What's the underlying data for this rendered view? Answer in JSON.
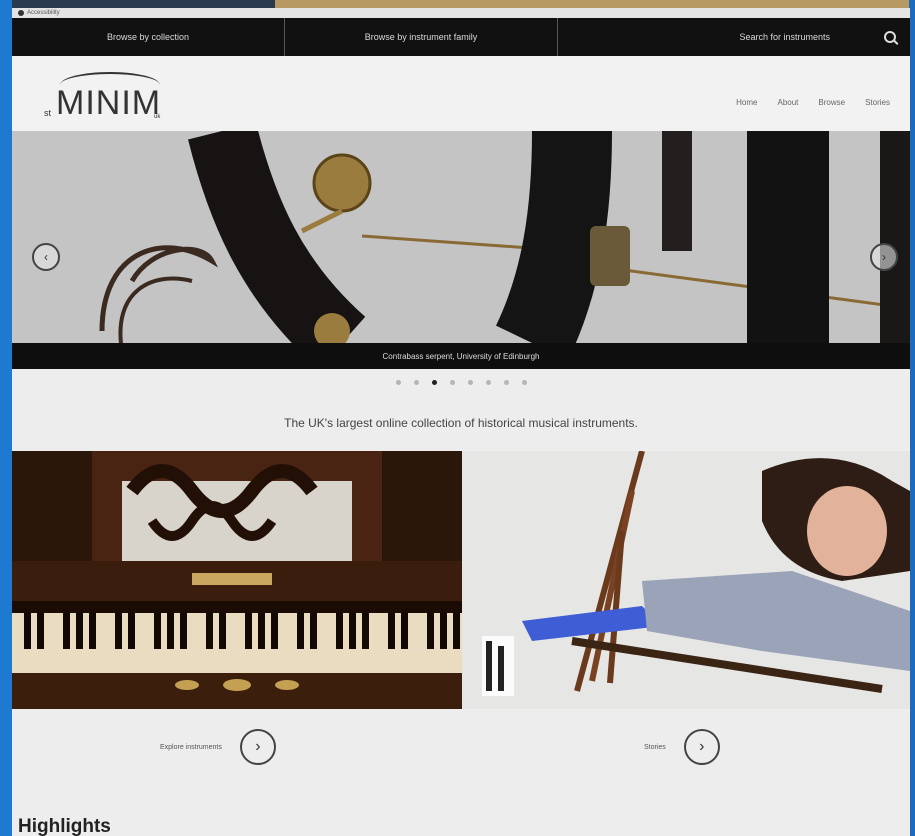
{
  "accessibility": {
    "label": "Accessibility"
  },
  "topnav": {
    "items": [
      "Browse by collection",
      "Browse by instrument family",
      "Search for instruments"
    ]
  },
  "logo": {
    "prefix": "st",
    "name": "MINIM",
    "suffix": "uk"
  },
  "mainnav": {
    "items": [
      "Home",
      "About",
      "Browse",
      "Stories"
    ]
  },
  "carousel": {
    "caption": "Contrabass serpent, University of Edinburgh",
    "slide_count": 8,
    "active_index": 2,
    "prev_glyph": "‹",
    "next_glyph": "›"
  },
  "tagline": "The UK's largest online collection of historical musical instruments.",
  "ctas": [
    {
      "label": "Explore instruments",
      "glyph": "›"
    },
    {
      "label": "Stories",
      "glyph": "›"
    }
  ],
  "highlights_title": "Highlights"
}
